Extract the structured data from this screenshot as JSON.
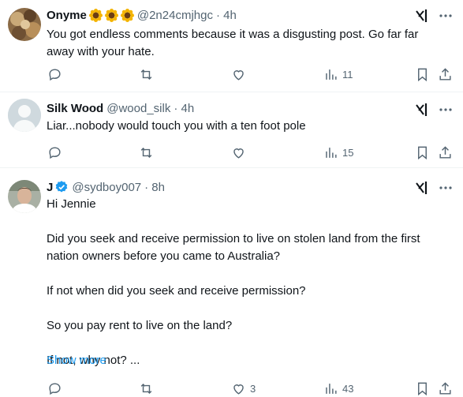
{
  "posts": [
    {
      "name": "Onyme",
      "handle": "@2n24cmjhgc",
      "time": "· 4h",
      "text": [
        "You got endless comments because it was a disgusting post. Go far far away with your hate."
      ],
      "replies": "",
      "reposts": "",
      "likes": "",
      "views": "11",
      "emoji": [
        "sunflower",
        "sunflower",
        "sunflower"
      ]
    },
    {
      "name": "Silk Wood",
      "handle": "@wood_silk",
      "time": "· 4h",
      "text": [
        "Liar...nobody would touch you with a ten foot pole"
      ],
      "replies": "",
      "reposts": "",
      "likes": "",
      "views": "15"
    },
    {
      "name": "J",
      "handle": "@sydboy007",
      "time": "· 8h",
      "verified": true,
      "text": [
        "Hi Jennie",
        "Did you seek and receive permission to live on stolen land from the first nation owners before you came to Australia?",
        "If not when did you seek and receive permission?",
        "So you pay rent to live on the land?",
        "If not, why not? ..."
      ],
      "show_more": "Show more",
      "replies": "",
      "reposts": "",
      "likes": "3",
      "views": "43"
    }
  ],
  "icons": {
    "reply": "reply-icon",
    "repost": "repost-icon",
    "like": "like-icon",
    "views": "views-icon",
    "bookmark": "bookmark-icon",
    "share": "share-icon",
    "grok": "grok-icon",
    "more": "more-icon"
  },
  "colors": {
    "text": "#0f1419",
    "secondary": "#536471",
    "link": "#1d9bf0",
    "verified": "#1d9bf0",
    "divider": "#eff3f4"
  }
}
